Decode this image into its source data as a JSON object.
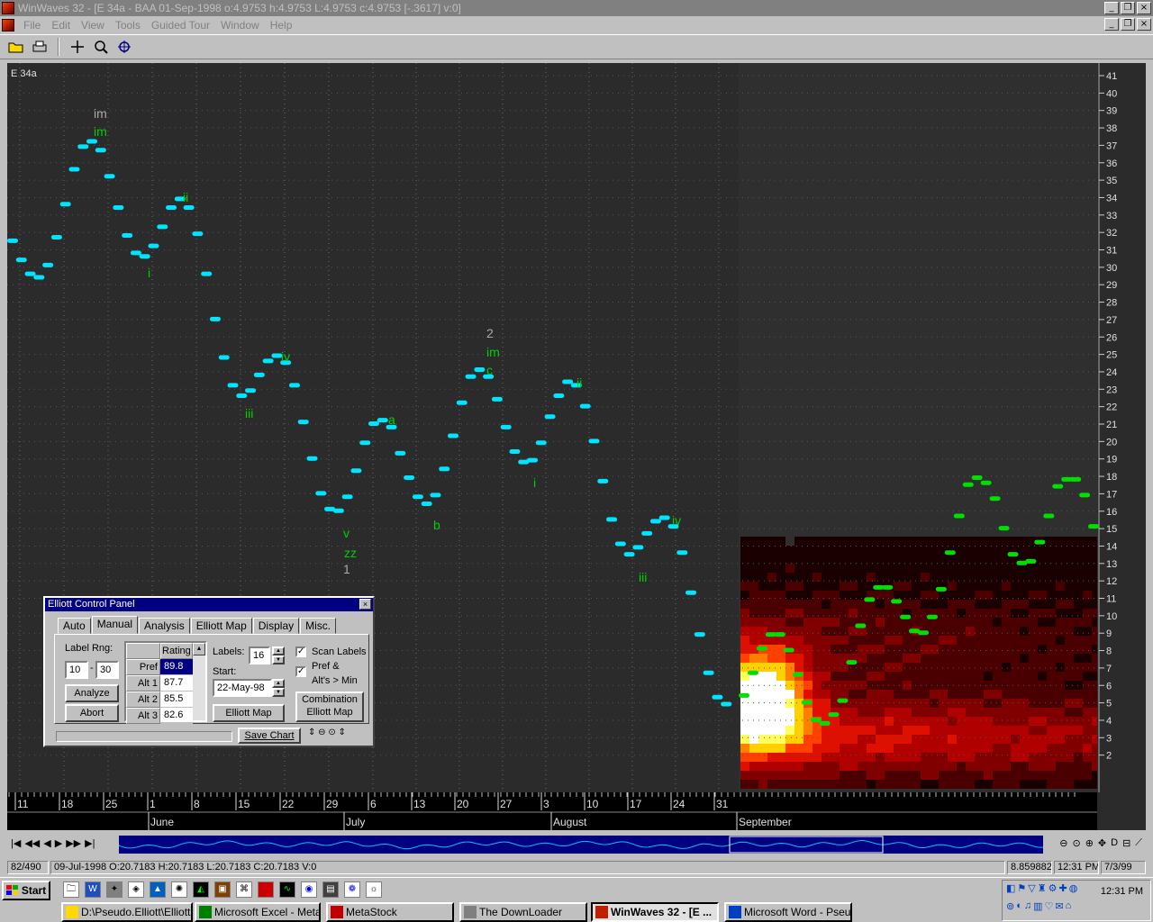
{
  "window": {
    "title": "WinWaves 32 - [E 34a - BAA     01-Sep-1998 o:4.9753 h:4.9753 L:4.9753 c:4.9753 [-.3617] v:0]",
    "min": "_",
    "restore": "❐",
    "close": "×"
  },
  "menu": [
    "File",
    "Edit",
    "View",
    "Tools",
    "Guided Tour",
    "Window",
    "Help"
  ],
  "chart": {
    "label": "E 34a",
    "y_ticks": [
      41,
      40,
      39,
      38,
      37,
      36,
      35,
      34,
      33,
      32,
      31,
      30,
      29,
      28,
      27,
      26,
      25,
      24,
      23,
      22,
      21,
      20,
      19,
      18,
      17,
      16,
      15,
      14,
      13,
      12,
      11,
      10,
      9,
      8,
      7,
      6,
      5,
      4,
      3,
      2
    ],
    "x_ticks": [
      "11",
      "18",
      "25",
      "1",
      "8",
      "15",
      "22",
      "29",
      "6",
      "13",
      "20",
      "27",
      "3",
      "10",
      "17",
      "24",
      "31"
    ],
    "months": [
      "June",
      "July",
      "August",
      "September"
    ],
    "wave_labels": [
      "im",
      "im",
      "ii",
      "i",
      "iii",
      "iv",
      "v",
      "zz",
      "1",
      "a",
      "b",
      "2",
      "im",
      "c",
      "i",
      "ii",
      "iii",
      "iv"
    ]
  },
  "chart_data": {
    "type": "scatter",
    "ylim": [
      1,
      41
    ],
    "price_series_color": "#00e5ff",
    "projection_series_color": "#00e000",
    "price": [
      31.5,
      30.4,
      29.6,
      29.4,
      30.1,
      31.7,
      33.6,
      35.6,
      36.9,
      37.2,
      36.7,
      35.2,
      33.4,
      31.8,
      30.8,
      30.6,
      31.2,
      32.3,
      33.4,
      33.9,
      33.4,
      31.9,
      29.6,
      27.0,
      24.8,
      23.2,
      22.6,
      22.9,
      23.8,
      24.6,
      24.9,
      24.5,
      23.2,
      21.1,
      19.0,
      17.0,
      16.1,
      16.0,
      16.8,
      18.3,
      19.9,
      21.0,
      21.2,
      20.8,
      19.3,
      17.9,
      16.8,
      16.4,
      16.9,
      18.4,
      20.3,
      22.2,
      23.7,
      24.1,
      23.7,
      22.4,
      20.8,
      19.4,
      18.8,
      18.9,
      19.9,
      21.4,
      22.6,
      23.4,
      23.2,
      22.0,
      20.0,
      17.7,
      15.5,
      14.1,
      13.5,
      13.9,
      14.7,
      15.4,
      15.6,
      15.1,
      13.6,
      11.3,
      8.9,
      6.7,
      5.3,
      4.9
    ],
    "projection": [
      5.4,
      6.7,
      8.1,
      8.9,
      8.9,
      8.0,
      6.6,
      5.0,
      4.0,
      3.8,
      4.3,
      5.1,
      7.3,
      9.4,
      10.9,
      11.6,
      11.6,
      10.8,
      9.9,
      9.1,
      9.0,
      9.9,
      11.5,
      13.6,
      15.7,
      17.5,
      17.9,
      17.6,
      16.7,
      15.0,
      13.5,
      13.0,
      13.1,
      14.2,
      15.7,
      17.4,
      17.8,
      17.8,
      16.9,
      15.1
    ]
  },
  "nav": {
    "left_buttons": [
      "|◀",
      "◀◀",
      "◀",
      "▶",
      "▶▶",
      "▶|"
    ],
    "right_buttons": [
      "⊖",
      "⊙",
      "⊕",
      "✥",
      "D",
      "⊟",
      "⟋"
    ]
  },
  "status": {
    "position": "82/490",
    "ohlc": "09-Jul-1998  O:20.7183 H:20.7183 L:20.7183 C:20.7183 V:0",
    "value": "8.859882",
    "time": "12:31 PM",
    "date": "7/3/99"
  },
  "panel": {
    "title": "Elliott Control Panel",
    "close": "×",
    "tabs": [
      "Auto",
      "Manual",
      "Analysis",
      "Elliott Map",
      "Display",
      "Misc."
    ],
    "label_rng_label": "Label Rng:",
    "label_rng_from": "10",
    "label_rng_sep": "-",
    "label_rng_to": "30",
    "analyze": "Analyze",
    "abort": "Abort",
    "rating_header": "Rating",
    "ratings": [
      {
        "name": "Pref",
        "value": "89.8"
      },
      {
        "name": "Alt 1",
        "value": "87.7"
      },
      {
        "name": "Alt 2",
        "value": "85.5"
      },
      {
        "name": "Alt 3",
        "value": "82.6"
      }
    ],
    "labels_label": "Labels:",
    "labels_value": "16",
    "start_label": "Start:",
    "start_value": "22-May-98",
    "elliott_map": "Elliott Map",
    "scan_labels": "Scan Labels",
    "pref_alt_line1": "Pref &",
    "pref_alt_line2": "Alt's > Min",
    "combination_line1": "Combination",
    "combination_line2": "Elliott Map",
    "save_chart": "Save Chart",
    "check": "✓"
  },
  "taskbar": {
    "start": "Start",
    "clock": "12:31 PM",
    "tasks": [
      "D:\\Pseudo.Elliott\\Elliott...",
      "Microsoft Excel - Meta...",
      "MetaStock",
      "The DownLoader",
      "WinWaves 32 - [E ...",
      "Microsoft Word - Pseud..."
    ]
  }
}
